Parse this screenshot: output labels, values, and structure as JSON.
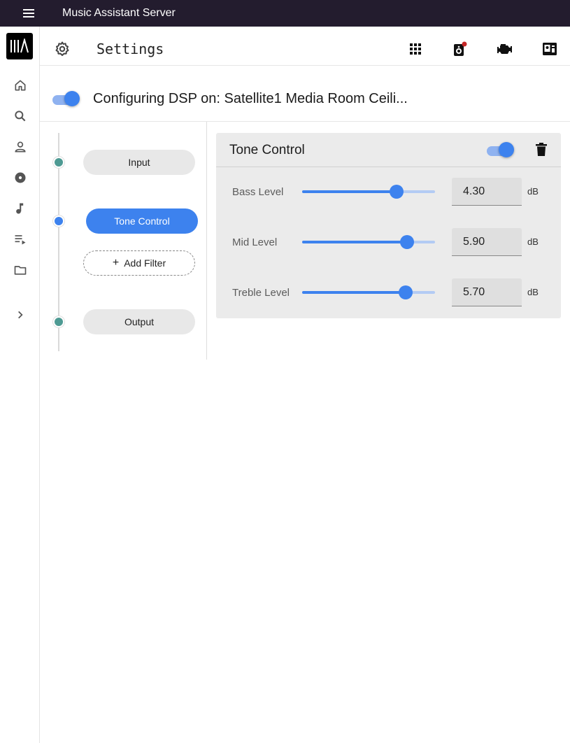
{
  "app": {
    "title": "Music Assistant Server"
  },
  "nav": {
    "items": [
      "home",
      "search",
      "artists",
      "albums",
      "tracks",
      "playlists",
      "browse",
      "expand"
    ]
  },
  "header": {
    "title": "Settings"
  },
  "dsp": {
    "enabled": true,
    "title": "Configuring DSP on: Satellite1 Media Room Ceili..."
  },
  "pipeline": {
    "input_label": "Input",
    "active_label": "Tone Control",
    "add_label": "Add Filter",
    "output_label": "Output"
  },
  "filter": {
    "title": "Tone Control",
    "enabled": true,
    "params": [
      {
        "label": "Bass Level",
        "value": "4.30",
        "unit": "dB",
        "slider_fraction": 0.71
      },
      {
        "label": "Mid Level",
        "value": "5.90",
        "unit": "dB",
        "slider_fraction": 0.79
      },
      {
        "label": "Treble Level",
        "value": "5.70",
        "unit": "dB",
        "slider_fraction": 0.78
      }
    ]
  },
  "colors": {
    "accent": "#3d82ee",
    "appbar": "#231c2e",
    "node": "#4e9a93"
  }
}
